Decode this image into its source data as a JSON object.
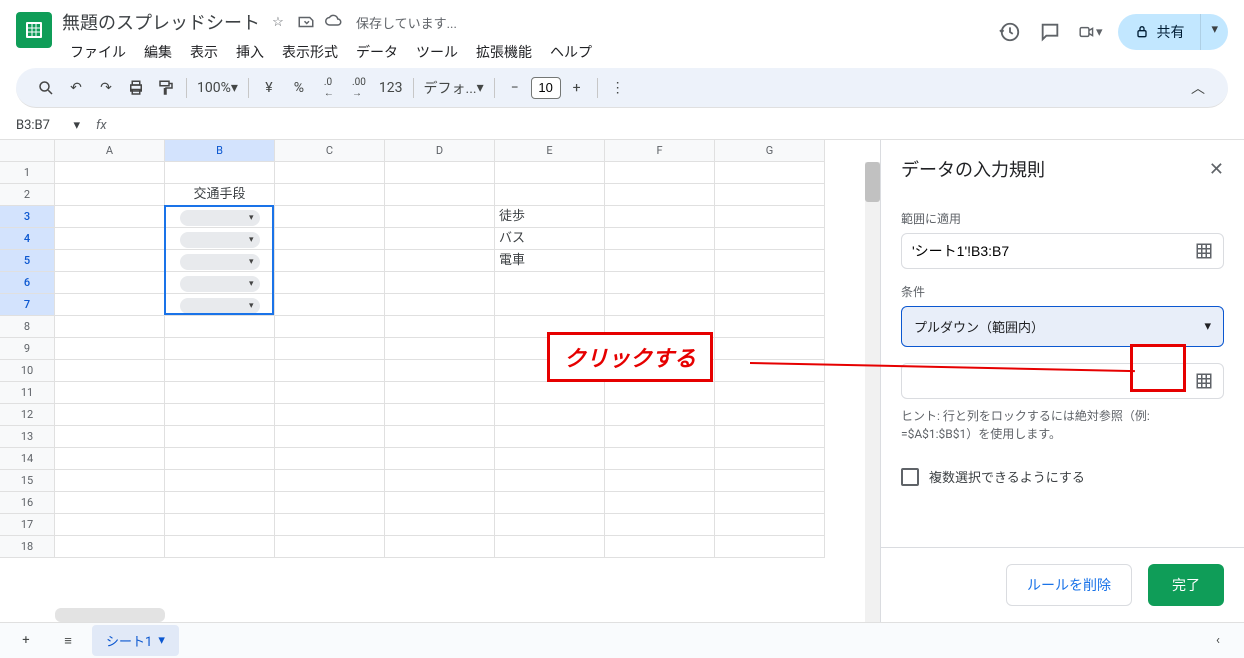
{
  "doc_title": "無題のスプレッドシート",
  "save_status": "保存しています...",
  "menu": [
    "ファイル",
    "編集",
    "表示",
    "挿入",
    "表示形式",
    "データ",
    "ツール",
    "拡張機能",
    "ヘルプ"
  ],
  "share_label": "共有",
  "toolbar": {
    "zoom": "100%",
    "font": "デフォ...",
    "font_size": "10",
    "currency": "¥",
    "percent": "%",
    "dec_dec": ".0",
    "inc_dec": ".00",
    "num_fmt": "123"
  },
  "name_box": "B3:B7",
  "formula": "",
  "columns": [
    "A",
    "B",
    "C",
    "D",
    "E",
    "F",
    "G"
  ],
  "selected_col": "B",
  "selected_rows": [
    3,
    4,
    5,
    6,
    7
  ],
  "row_count": 18,
  "sheet_data": {
    "B2": "交通手段",
    "E3": "徒歩",
    "E4": "バス",
    "E5": "電車"
  },
  "chip_rows": [
    3,
    4,
    5,
    6,
    7
  ],
  "sidebar": {
    "title": "データの入力規則",
    "range_label": "範囲に適用",
    "range_value": "'シート1'!B3:B7",
    "condition_label": "条件",
    "condition_value": "プルダウン（範囲内）",
    "source_value": "",
    "hint": "ヒント: 行と列をロックするには絶対参照（例: =$A$1:$B$1）を使用します。",
    "multi_label": "複数選択できるようにする",
    "delete_btn": "ルールを削除",
    "done_btn": "完了"
  },
  "sheet_tab": "シート1",
  "annotation": "クリックする"
}
